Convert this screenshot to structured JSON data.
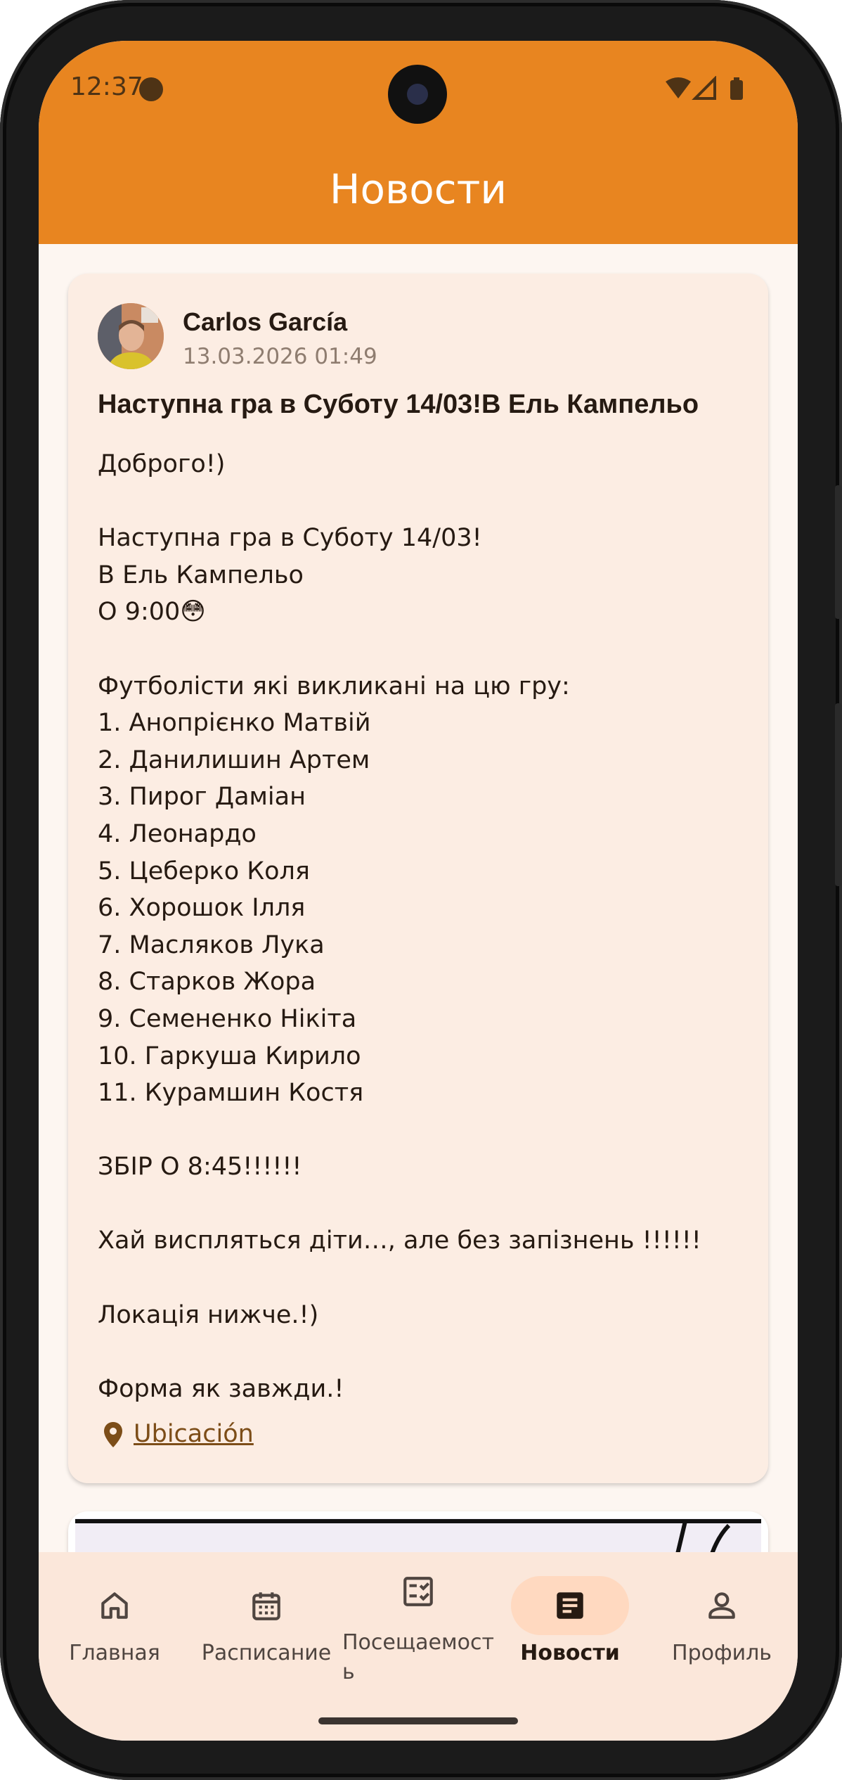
{
  "status_bar": {
    "time": "12:37"
  },
  "app_bar": {
    "title": "Новости",
    "color": "#e88520"
  },
  "post": {
    "author": "Carlos García",
    "date": "13.03.2026 01:49",
    "title": "Наступна гра в Суботу 14/03!В Ель Кампельо",
    "body": "Доброго!)\n\nНаступна гра в Суботу 14/03!\nВ Ель Кампельо\nО 9:00😳\n\nФутболісти які викликані на цю гру:\n1. Анопрієнко Матвій\n2. Данилишин Артем\n3. Пирог Даміан\n4. Леонардо\n5. Цеберко Коля\n6. Хорошок Ілля\n7. Масляков Лука\n8. Старков Жора\n9. Семененко Нікіта\n10. Гаркуша Кирило\n11. Курамшин Костя\n\nЗБІР О 8:45!!!!!!\n\nХай виспляться діти…, але без запізнень !!!!!!\n\nЛокація нижче.!)\n\nФорма як завжди.!",
    "location_label": "Ubicación"
  },
  "bottom_nav": {
    "items": [
      {
        "label": "Главная",
        "icon": "home-icon",
        "active": false
      },
      {
        "label": "Расписание",
        "icon": "calendar-icon",
        "active": false
      },
      {
        "label": "Посещаемость",
        "icon": "attendance-icon",
        "active": false
      },
      {
        "label": "Новости",
        "icon": "news-icon",
        "active": true
      },
      {
        "label": "Профиль",
        "icon": "profile-icon",
        "active": false
      }
    ],
    "active_pill_color": "#ffd9c0"
  }
}
